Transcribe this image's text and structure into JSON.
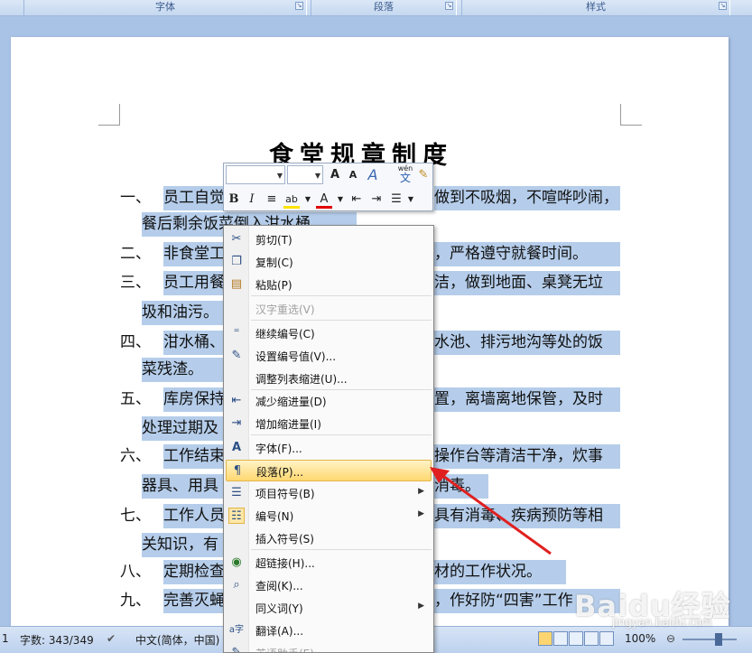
{
  "ribbon": {
    "group_font": "字体",
    "group_paragraph": "段落",
    "group_styles": "样式"
  },
  "document": {
    "title": "食堂规章制度",
    "lines": [
      {
        "num": "一、",
        "text": "员工自觉"
      },
      {
        "num": "",
        "text": "餐后剩余饭菜倒入泔水桶"
      },
      {
        "num": "二、",
        "text": "非食堂工"
      },
      {
        "num": "三、",
        "text": "员工用餐"
      },
      {
        "num": "",
        "text": "圾和油污。"
      },
      {
        "num": "四、",
        "text": "泔水桶、"
      },
      {
        "num": "",
        "text": "菜残渣。"
      },
      {
        "num": "五、",
        "text": "库房保持"
      },
      {
        "num": "",
        "text": "处理过期及"
      },
      {
        "num": "六、",
        "text": "工作结束"
      },
      {
        "num": "",
        "text": "器具、用具"
      },
      {
        "num": "七、",
        "text": "工作人员"
      },
      {
        "num": "",
        "text": "关知识，有"
      },
      {
        "num": "八、",
        "text": "定期检查"
      },
      {
        "num": "九、",
        "text": "完善灭蝇"
      }
    ],
    "right_fragments": [
      "做到不吸烟，不喧哗吵闹，",
      "，严格遵守就餐时间。",
      "洁，做到地面、桌凳无垃",
      "水池、排污地沟等处的饭",
      "置，离墙离地保管，及时",
      "操作台等清洁干净，炊事",
      "消毒。",
      "具有消毒、疾病预防等相",
      "材的工作状况。",
      "，作好防“四害”工作"
    ]
  },
  "mini_toolbar": {
    "grow_font": "A",
    "shrink_font": "A",
    "style_icon": "A",
    "wen": "wén",
    "wen_char": "文",
    "bold": "B",
    "italic": "I",
    "highlight": "ab",
    "font_color": "A"
  },
  "context_menu": {
    "items": [
      {
        "label": "剪切(T)",
        "icon": "scissors-icon"
      },
      {
        "label": "复制(C)",
        "icon": "copy-icon"
      },
      {
        "label": "粘贴(P)",
        "icon": "paste-icon"
      },
      {
        "label": "汉字重选(V)",
        "icon": "",
        "disabled": true
      },
      {
        "label": "继续编号(C)",
        "icon": "continue-numbering-icon"
      },
      {
        "label": "设置编号值(V)...",
        "icon": "set-number-icon"
      },
      {
        "label": "调整列表缩进(U)...",
        "icon": ""
      },
      {
        "label": "减少缩进量(D)",
        "icon": "decrease-indent-icon"
      },
      {
        "label": "增加缩进量(I)",
        "icon": "increase-indent-icon"
      },
      {
        "label": "字体(F)...",
        "icon": "font-icon"
      },
      {
        "label": "段落(P)...",
        "icon": "paragraph-icon",
        "active": true
      },
      {
        "label": "项目符号(B)",
        "icon": "bullets-icon",
        "submenu": true
      },
      {
        "label": "编号(N)",
        "icon": "numbering-icon",
        "submenu": true
      },
      {
        "label": "插入符号(S)",
        "icon": ""
      },
      {
        "label": "超链接(H)...",
        "icon": "hyperlink-icon"
      },
      {
        "label": "查阅(K)...",
        "icon": "research-icon"
      },
      {
        "label": "同义词(Y)",
        "icon": "",
        "submenu": true
      },
      {
        "label": "翻译(A)...",
        "icon": "translate-icon"
      },
      {
        "label": "英语助手(E)",
        "icon": "english-assistant-icon"
      }
    ]
  },
  "status_bar": {
    "page_num": "1",
    "word_count": "字数: 343/349",
    "language": "中文(简体，中国)",
    "zoom": "100%"
  },
  "watermark": {
    "logo": "Baidu经验",
    "url": "jingyan.baidu.com"
  },
  "colors": {
    "selection": "#b5cdea",
    "active_item": "#ffd870",
    "arrow": "#e02020"
  }
}
